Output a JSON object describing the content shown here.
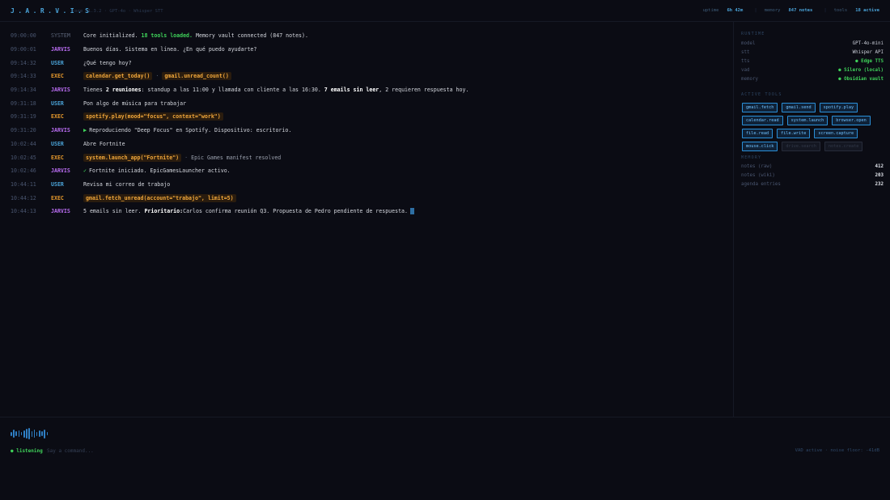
{
  "header": {
    "brand": "J.A.R.V.I.S",
    "build": "core v1.3.2 · GPT-4o · Whisper STT",
    "stats": [
      {
        "label": "uptime",
        "value": "6h 42m"
      },
      {
        "label": "memory",
        "value": "847 notes"
      },
      {
        "label": "tools",
        "value": "18 active"
      }
    ]
  },
  "log": [
    {
      "ts": "09:00:00",
      "tag": "SYSTEM",
      "pre": "Core initialized. ",
      "green": "18 tools loaded.",
      "post": " Memory vault connected (847 notes)."
    },
    {
      "ts": "09:00:01",
      "tag": "JARVIS",
      "text": "Buenos días. Sistema en línea. ¿En qué puedo ayudarte?"
    },
    {
      "ts": "09:14:32",
      "tag": "USER",
      "text": "¿Qué tengo hoy?"
    },
    {
      "ts": "09:14:33",
      "tag": "EXEC",
      "chip1": "calendar.get_today()",
      "sep": "·",
      "chip2": "gmail.unread_count()"
    },
    {
      "ts": "09:14:34",
      "tag": "JARVIS",
      "a": "Tienes ",
      "b1": "2 reuniones",
      "c": ": standup a las 11:00 y llamada con cliente a las 16:30. ",
      "b2": "7 emails sin leer",
      "d": ", 2 requieren respuesta hoy."
    },
    {
      "ts": "09:31:18",
      "tag": "USER",
      "text": "Pon algo de música para trabajar"
    },
    {
      "ts": "09:31:19",
      "tag": "EXEC",
      "chip1": "spotify.play(mood=\"focus\", context=\"work\")"
    },
    {
      "ts": "09:31:20",
      "tag": "JARVIS",
      "text": "Reproduciendo \"Deep Focus\" en Spotify. Dispositivo: escritorio."
    },
    {
      "ts": "10:02:44",
      "tag": "USER",
      "text": "Abre Fortnite"
    },
    {
      "ts": "10:02:45",
      "tag": "EXEC",
      "chip1": "system.launch_app(\"Fortnite\")",
      "sep": "·",
      "note": "Epic Games manifest resolved"
    },
    {
      "ts": "10:02:46",
      "tag": "JARVIS",
      "text": "Fortnite iniciado. EpicGamesLauncher activo."
    },
    {
      "ts": "10:44:11",
      "tag": "USER",
      "text": "Revisa mi correo de trabajo"
    },
    {
      "ts": "10:44:12",
      "tag": "EXEC",
      "chip1": "gmail.fetch_unread(account=\"trabajo\", limit=5)"
    },
    {
      "ts": "10:44:13",
      "tag": "JARVIS",
      "a": "5 emails sin leer. ",
      "b1": "Prioritario:",
      "c": " Carlos confirma reunión Q3. Propuesta de Pedro pendiente de respuesta."
    }
  ],
  "sidebar": {
    "runtime_title": "RUNTIME",
    "runtime": [
      {
        "k": "model",
        "v": "GPT-4o-mini"
      },
      {
        "k": "stt",
        "v": "Whisper API"
      },
      {
        "k": "tts",
        "v": "● Edge TTS"
      },
      {
        "k": "vad",
        "v": "● Silero (local)"
      },
      {
        "k": "memory",
        "v": "● Obsidian vault"
      }
    ],
    "tools_title": "ACTIVE TOOLS",
    "tools": [
      {
        "label": "gmail.fetch",
        "on": true
      },
      {
        "label": "gmail.send",
        "on": true
      },
      {
        "label": "spotify.play",
        "on": true
      },
      {
        "label": "calendar.read",
        "on": true
      },
      {
        "label": "system.launch",
        "on": true
      },
      {
        "label": "browser.open",
        "on": true
      },
      {
        "label": "file.read",
        "on": true
      },
      {
        "label": "file.write",
        "on": true
      },
      {
        "label": "screen.capture",
        "on": true
      },
      {
        "label": "mouse.click",
        "on": true
      },
      {
        "label": "drive.search",
        "on": false
      },
      {
        "label": "notes.create",
        "on": false
      }
    ],
    "memory_title": "MEMORY",
    "memory": [
      {
        "k": "notes (raw)",
        "v": "412"
      },
      {
        "k": "notes (wiki)",
        "v": "203"
      },
      {
        "k": "agenda entries",
        "v": "232"
      }
    ]
  },
  "bottom": {
    "status": "● listening",
    "prompt": "Say a command...",
    "vad_status": "VAD active · noise floor: -41dB"
  },
  "colors": {
    "accent": "#4aa3d8",
    "jarvis": "#b86cf0",
    "exec": "#e89a2c",
    "success": "#3fd35a",
    "background": "#0b0c14"
  }
}
